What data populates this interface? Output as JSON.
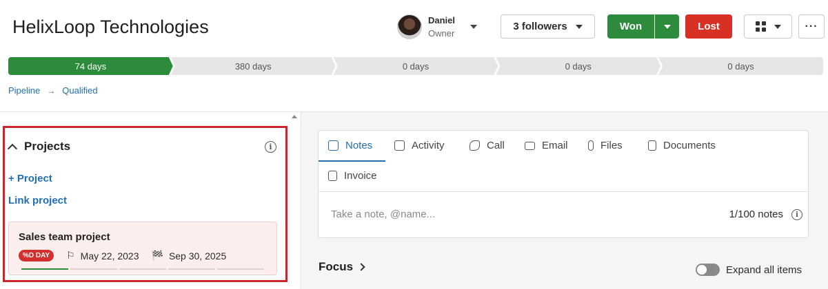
{
  "header": {
    "title": "HelixLoop Technologies",
    "owner": {
      "name": "Daniel",
      "role": "Owner"
    },
    "followers_label": "3 followers",
    "won_label": "Won",
    "lost_label": "Lost",
    "more_label": "···"
  },
  "pipeline": {
    "stages": [
      {
        "label": "74 days",
        "active": true
      },
      {
        "label": "380 days",
        "active": false
      },
      {
        "label": "0 days",
        "active": false
      },
      {
        "label": "0 days",
        "active": false
      },
      {
        "label": "0 days",
        "active": false
      }
    ],
    "breadcrumb": [
      "Pipeline",
      "Qualified"
    ]
  },
  "projects": {
    "title": "Projects",
    "add_label": "+ Project",
    "link_label": "Link project",
    "card": {
      "title": "Sales team project",
      "badge": "%D DAY",
      "start_date": "May 22, 2023",
      "end_date": "Sep 30, 2025"
    }
  },
  "notes": {
    "tabs": [
      {
        "label": "Notes",
        "icon": "notes-icon",
        "active": true
      },
      {
        "label": "Activity",
        "icon": "calendar-icon",
        "active": false
      },
      {
        "label": "Call",
        "icon": "phone-icon",
        "active": false
      },
      {
        "label": "Email",
        "icon": "envelope-icon",
        "active": false
      },
      {
        "label": "Files",
        "icon": "paperclip-icon",
        "active": false
      },
      {
        "label": "Documents",
        "icon": "document-icon",
        "active": false
      },
      {
        "label": "Invoice",
        "icon": "invoice-icon",
        "active": false
      }
    ],
    "placeholder": "Take a note, @name...",
    "count": "1/100 notes"
  },
  "focus": {
    "title": "Focus",
    "expand_label": "Expand all items"
  },
  "colors": {
    "accent_green": "#2d8c3c",
    "accent_red": "#d93025",
    "link_blue": "#1f6fb2",
    "highlight_frame": "#d0222a"
  }
}
